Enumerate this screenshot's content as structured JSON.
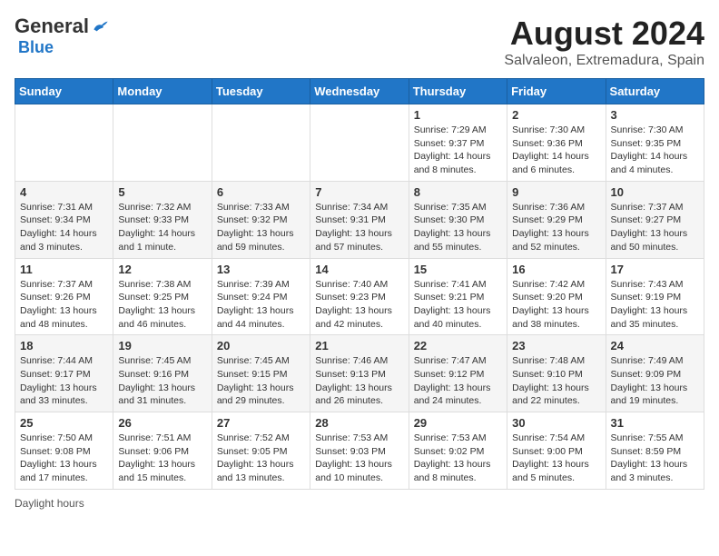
{
  "header": {
    "logo_general": "General",
    "logo_blue": "Blue",
    "title": "August 2024",
    "subtitle": "Salvaleon, Extremadura, Spain"
  },
  "calendar": {
    "days_of_week": [
      "Sunday",
      "Monday",
      "Tuesday",
      "Wednesday",
      "Thursday",
      "Friday",
      "Saturday"
    ],
    "weeks": [
      [
        {
          "day": "",
          "info": ""
        },
        {
          "day": "",
          "info": ""
        },
        {
          "day": "",
          "info": ""
        },
        {
          "day": "",
          "info": ""
        },
        {
          "day": "1",
          "info": "Sunrise: 7:29 AM\nSunset: 9:37 PM\nDaylight: 14 hours\nand 8 minutes."
        },
        {
          "day": "2",
          "info": "Sunrise: 7:30 AM\nSunset: 9:36 PM\nDaylight: 14 hours\nand 6 minutes."
        },
        {
          "day": "3",
          "info": "Sunrise: 7:30 AM\nSunset: 9:35 PM\nDaylight: 14 hours\nand 4 minutes."
        }
      ],
      [
        {
          "day": "4",
          "info": "Sunrise: 7:31 AM\nSunset: 9:34 PM\nDaylight: 14 hours\nand 3 minutes."
        },
        {
          "day": "5",
          "info": "Sunrise: 7:32 AM\nSunset: 9:33 PM\nDaylight: 14 hours\nand 1 minute."
        },
        {
          "day": "6",
          "info": "Sunrise: 7:33 AM\nSunset: 9:32 PM\nDaylight: 13 hours\nand 59 minutes."
        },
        {
          "day": "7",
          "info": "Sunrise: 7:34 AM\nSunset: 9:31 PM\nDaylight: 13 hours\nand 57 minutes."
        },
        {
          "day": "8",
          "info": "Sunrise: 7:35 AM\nSunset: 9:30 PM\nDaylight: 13 hours\nand 55 minutes."
        },
        {
          "day": "9",
          "info": "Sunrise: 7:36 AM\nSunset: 9:29 PM\nDaylight: 13 hours\nand 52 minutes."
        },
        {
          "day": "10",
          "info": "Sunrise: 7:37 AM\nSunset: 9:27 PM\nDaylight: 13 hours\nand 50 minutes."
        }
      ],
      [
        {
          "day": "11",
          "info": "Sunrise: 7:37 AM\nSunset: 9:26 PM\nDaylight: 13 hours\nand 48 minutes."
        },
        {
          "day": "12",
          "info": "Sunrise: 7:38 AM\nSunset: 9:25 PM\nDaylight: 13 hours\nand 46 minutes."
        },
        {
          "day": "13",
          "info": "Sunrise: 7:39 AM\nSunset: 9:24 PM\nDaylight: 13 hours\nand 44 minutes."
        },
        {
          "day": "14",
          "info": "Sunrise: 7:40 AM\nSunset: 9:23 PM\nDaylight: 13 hours\nand 42 minutes."
        },
        {
          "day": "15",
          "info": "Sunrise: 7:41 AM\nSunset: 9:21 PM\nDaylight: 13 hours\nand 40 minutes."
        },
        {
          "day": "16",
          "info": "Sunrise: 7:42 AM\nSunset: 9:20 PM\nDaylight: 13 hours\nand 38 minutes."
        },
        {
          "day": "17",
          "info": "Sunrise: 7:43 AM\nSunset: 9:19 PM\nDaylight: 13 hours\nand 35 minutes."
        }
      ],
      [
        {
          "day": "18",
          "info": "Sunrise: 7:44 AM\nSunset: 9:17 PM\nDaylight: 13 hours\nand 33 minutes."
        },
        {
          "day": "19",
          "info": "Sunrise: 7:45 AM\nSunset: 9:16 PM\nDaylight: 13 hours\nand 31 minutes."
        },
        {
          "day": "20",
          "info": "Sunrise: 7:45 AM\nSunset: 9:15 PM\nDaylight: 13 hours\nand 29 minutes."
        },
        {
          "day": "21",
          "info": "Sunrise: 7:46 AM\nSunset: 9:13 PM\nDaylight: 13 hours\nand 26 minutes."
        },
        {
          "day": "22",
          "info": "Sunrise: 7:47 AM\nSunset: 9:12 PM\nDaylight: 13 hours\nand 24 minutes."
        },
        {
          "day": "23",
          "info": "Sunrise: 7:48 AM\nSunset: 9:10 PM\nDaylight: 13 hours\nand 22 minutes."
        },
        {
          "day": "24",
          "info": "Sunrise: 7:49 AM\nSunset: 9:09 PM\nDaylight: 13 hours\nand 19 minutes."
        }
      ],
      [
        {
          "day": "25",
          "info": "Sunrise: 7:50 AM\nSunset: 9:08 PM\nDaylight: 13 hours\nand 17 minutes."
        },
        {
          "day": "26",
          "info": "Sunrise: 7:51 AM\nSunset: 9:06 PM\nDaylight: 13 hours\nand 15 minutes."
        },
        {
          "day": "27",
          "info": "Sunrise: 7:52 AM\nSunset: 9:05 PM\nDaylight: 13 hours\nand 13 minutes."
        },
        {
          "day": "28",
          "info": "Sunrise: 7:53 AM\nSunset: 9:03 PM\nDaylight: 13 hours\nand 10 minutes."
        },
        {
          "day": "29",
          "info": "Sunrise: 7:53 AM\nSunset: 9:02 PM\nDaylight: 13 hours\nand 8 minutes."
        },
        {
          "day": "30",
          "info": "Sunrise: 7:54 AM\nSunset: 9:00 PM\nDaylight: 13 hours\nand 5 minutes."
        },
        {
          "day": "31",
          "info": "Sunrise: 7:55 AM\nSunset: 8:59 PM\nDaylight: 13 hours\nand 3 minutes."
        }
      ]
    ]
  },
  "footer": {
    "daylight_hours_label": "Daylight hours"
  }
}
